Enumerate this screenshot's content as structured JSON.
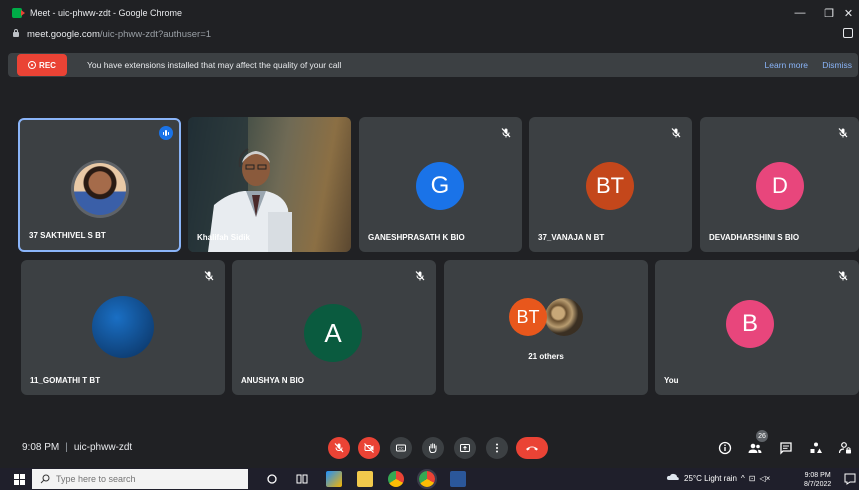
{
  "browser": {
    "title": "Meet - uic-phww-zdt - Google Chrome",
    "url_host": "meet.google.com",
    "url_path": "/uic-phww-zdt?authuser=1",
    "min_glyph": "—",
    "max_glyph": "❐",
    "close_glyph": "✕"
  },
  "infobar": {
    "rec_label": "REC",
    "message": "You have extensions installed that may affect the quality of your call",
    "learn_more": "Learn more",
    "dismiss": "Dismiss"
  },
  "participants": {
    "row1": [
      {
        "name": "37 SAKTHIVEL S BT"
      },
      {
        "name": "Khalifah Sidik"
      },
      {
        "name": "GANESHPRASATH K BIO",
        "initial": "G",
        "color": "#1a73e8"
      },
      {
        "name": "37_VANAJA N BT",
        "initial": "BT",
        "color": "#c4471b"
      },
      {
        "name": "DEVADHARSHINI S BIO",
        "initial": "D",
        "color": "#e8467c"
      }
    ],
    "row2": [
      {
        "name": "11_GOMATHI T BT",
        "color": "#0b57a8"
      },
      {
        "name": "ANUSHYA N BIO",
        "initial": "A",
        "color": "#0a5b3f"
      },
      {
        "name": "",
        "initial": "BT",
        "color": "#e8571c",
        "others": "21 others"
      },
      {
        "name": "You",
        "initial": "B",
        "color": "#e8467c"
      }
    ]
  },
  "meeting": {
    "time": "9:08 PM",
    "code": "uic-phww-zdt",
    "participant_count": "26"
  },
  "taskbar": {
    "search_placeholder": "Type here to search",
    "weather": "25°C  Light rain",
    "clock_time": "9:08 PM",
    "clock_date": "8/7/2022"
  }
}
